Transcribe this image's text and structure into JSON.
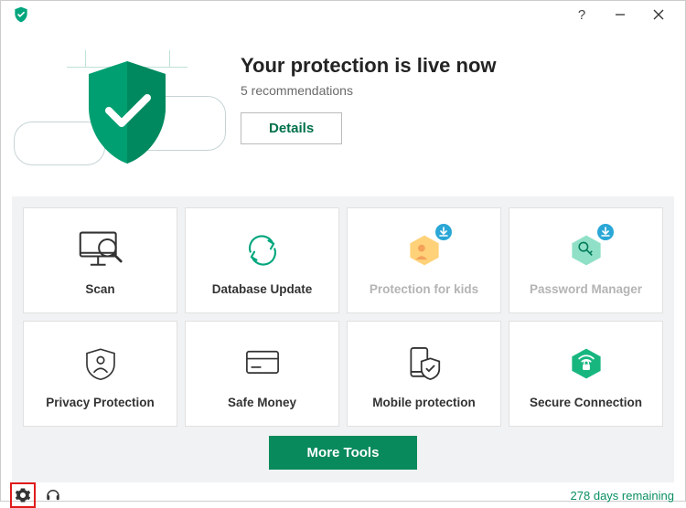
{
  "titlebar": {
    "help": "?"
  },
  "hero": {
    "title": "Your protection is live now",
    "subtitle": "5 recommendations",
    "details_label": "Details"
  },
  "tiles": [
    {
      "label": "Scan"
    },
    {
      "label": "Database Update"
    },
    {
      "label": "Protection for kids"
    },
    {
      "label": "Password Manager"
    },
    {
      "label": "Privacy Protection"
    },
    {
      "label": "Safe Money"
    },
    {
      "label": "Mobile protection"
    },
    {
      "label": "Secure Connection"
    }
  ],
  "more_tools_label": "More Tools",
  "footer": {
    "license_text": "278 days remaining"
  }
}
